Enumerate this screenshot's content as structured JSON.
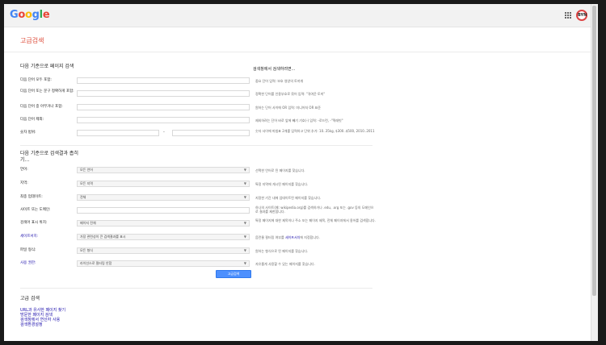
{
  "logo": {
    "letters": [
      "G",
      "o",
      "o",
      "g",
      "l",
      "e"
    ],
    "colors": [
      "#4285f4",
      "#ea4335",
      "#fbbc05",
      "#4285f4",
      "#34a853",
      "#ea4335"
    ]
  },
  "account": {
    "avatar_text": "BYN"
  },
  "page": {
    "title": "고급검색"
  },
  "find_pages": {
    "heading": "다음 기준으로 페이지 검색",
    "side_heading": "검색창에서 검색하려면...",
    "rows": [
      {
        "label": "다음 단어 모두 포함:",
        "hint": "중요 단어 입력: 보호 영양의 토끼개"
      },
      {
        "label": "다음 단어 또는 문구 정확하게 포함:",
        "hint": "정확한 단어를 인용부호로 묶어 입력: \"귀여운 토끼\""
      },
      {
        "label": "다음 단어 중 아무거나 포함:",
        "hint": "원하는 단어 사이에 OR 입력: 미니어처 OR 표준"
      },
      {
        "label": "다음 단어 제외:",
        "hint": "제외하려는 단어 바로 앞에 빼기 기호(-) 입력: -로드런, -\"잭래빗\""
      },
      {
        "label": "숫자 범위:",
        "dash": "-",
        "hint": "숫자 사이에 마침표 2개를 입력하고 단위 추가: 10..35kg, $300..$500, 2010..2011"
      }
    ]
  },
  "narrow": {
    "heading": "다음 기준으로 검색결과 좁히기...",
    "rows": [
      {
        "label": "언어:",
        "value": "모든 언어",
        "hint": "선택한 언어로 된 페이지를 찾습니다.",
        "link": false
      },
      {
        "label": "지역:",
        "value": "모든 지역",
        "hint": "특정 지역에 게시된 페이지를 찾습니다.",
        "link": false
      },
      {
        "label": "최종 업데이트:",
        "value": "전체",
        "hint": "지정한 기간 내에 업데이트된 페이지를 찾습니다.",
        "link": false
      },
      {
        "label": "사이트 또는 도메인:",
        "value": "",
        "hint": "하나의 사이트(예: wikipedia.org)를 검색하거나 .edu, .org 또는 .gov 등의 도메인으로 결과를 제한합니다.",
        "link": false
      },
      {
        "label": "검색어 표시 위치:",
        "value": "페이지 전체",
        "hint": "특정 페이지에 대한 제목이나 주소 또는 페이지 제목, 전체 페이지에서 용어를 검색합니다.",
        "link": false
      },
      {
        "label": "세이프서치:",
        "value": "가장 관련성이 큰 검색결과를 표시",
        "hint": "음란물 필터링 여부를 세이프서치에 지정합니다.",
        "hint_link": "세이프서치",
        "link": true
      },
      {
        "label": "파일 형식:",
        "value": "모든 형식",
        "hint": "원하는 형식으로 된 페이지를 찾습니다.",
        "link": false
      },
      {
        "label": "사용 권한:",
        "value": "라이선스로 필터링 안함",
        "hint": "자유롭게 사용할 수 있는 페이지를 찾습니다.",
        "link": true
      }
    ]
  },
  "search_button": "고급검색",
  "bottom": {
    "heading": "고급 검색",
    "links": [
      "URL과 유사한 페이지 찾기",
      "방문한 페이지 검색",
      "검색창에서 연산자 사용",
      "검색환경설정"
    ]
  },
  "colors": {
    "accent": "#dd4b39",
    "link": "#1a0dab",
    "button": "#4d90fe"
  }
}
